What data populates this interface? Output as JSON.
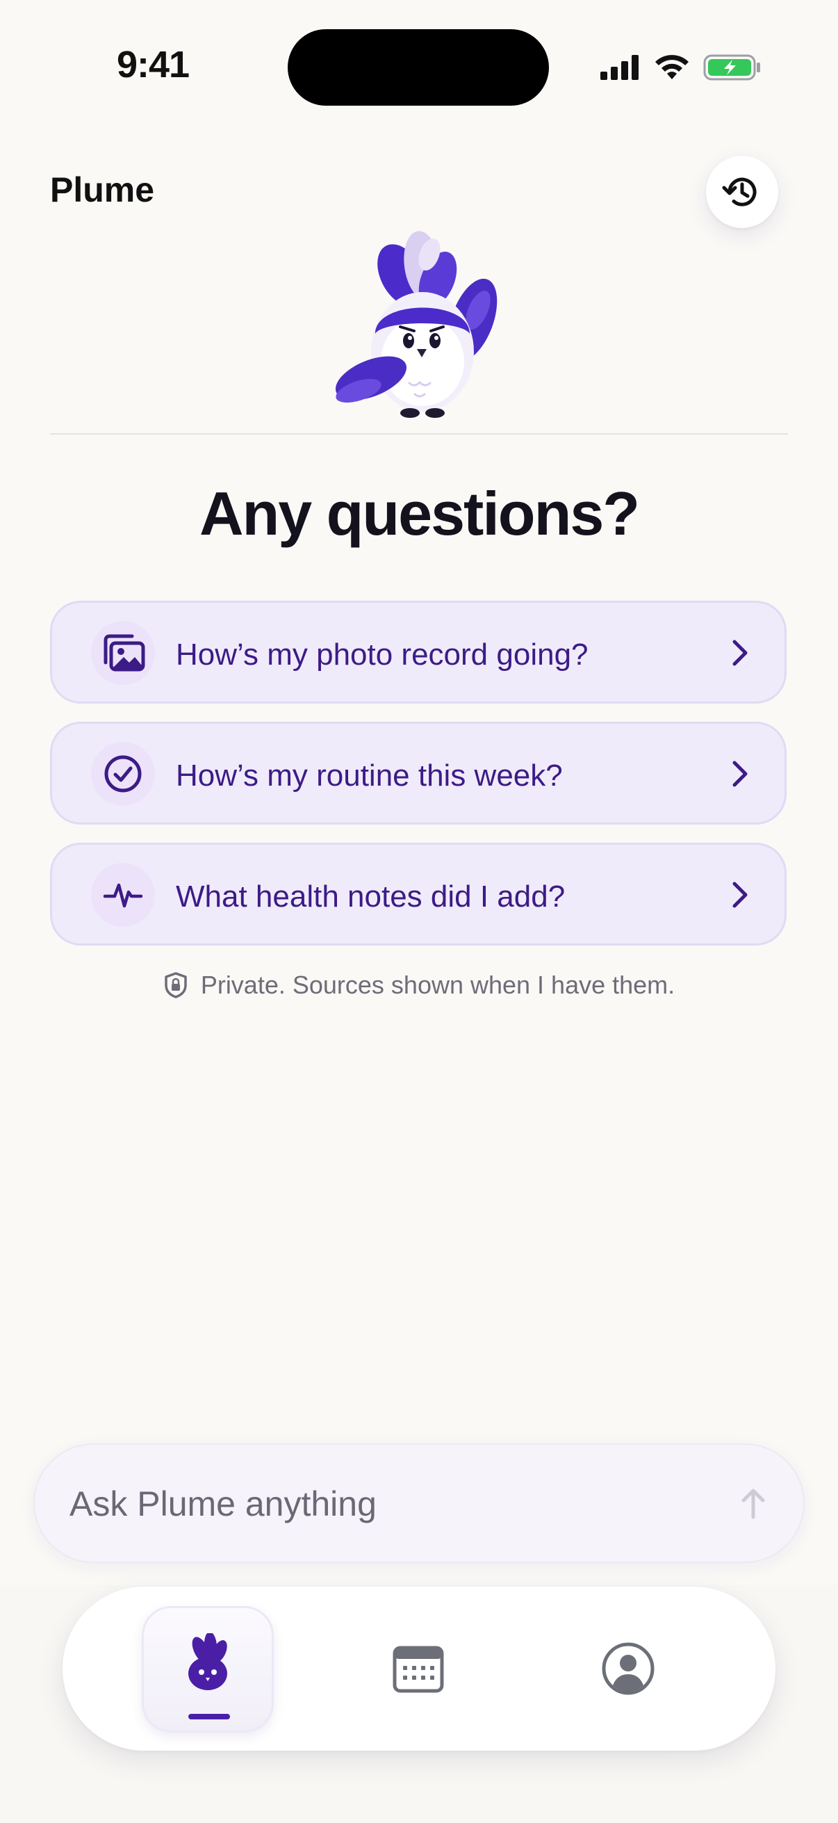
{
  "status_bar": {
    "time": "9:41"
  },
  "header": {
    "title": "Plume",
    "history_icon": "history-icon"
  },
  "main": {
    "heading": "Any questions?",
    "suggestions": [
      {
        "label": "How’s my photo record going?",
        "icon": "photos-icon"
      },
      {
        "label": "How’s my routine this week?",
        "icon": "check-circle-icon"
      },
      {
        "label": "What health notes did I add?",
        "icon": "heart-pulse-icon"
      }
    ],
    "privacy_note": "Private. Sources shown when I have them."
  },
  "composer": {
    "placeholder": "Ask Plume anything"
  },
  "tab_bar": {
    "tabs": [
      {
        "name": "plume",
        "icon": "plume-icon",
        "active": true
      },
      {
        "name": "calendar",
        "icon": "calendar-icon",
        "active": false
      },
      {
        "name": "profile",
        "icon": "profile-icon",
        "active": false
      }
    ]
  },
  "colors": {
    "accent": "#4A1FA6",
    "card_bg": "#F0EBFA",
    "card_text": "#3C1B86",
    "background": "#FAF9F6",
    "battery_green": "#34C759"
  }
}
